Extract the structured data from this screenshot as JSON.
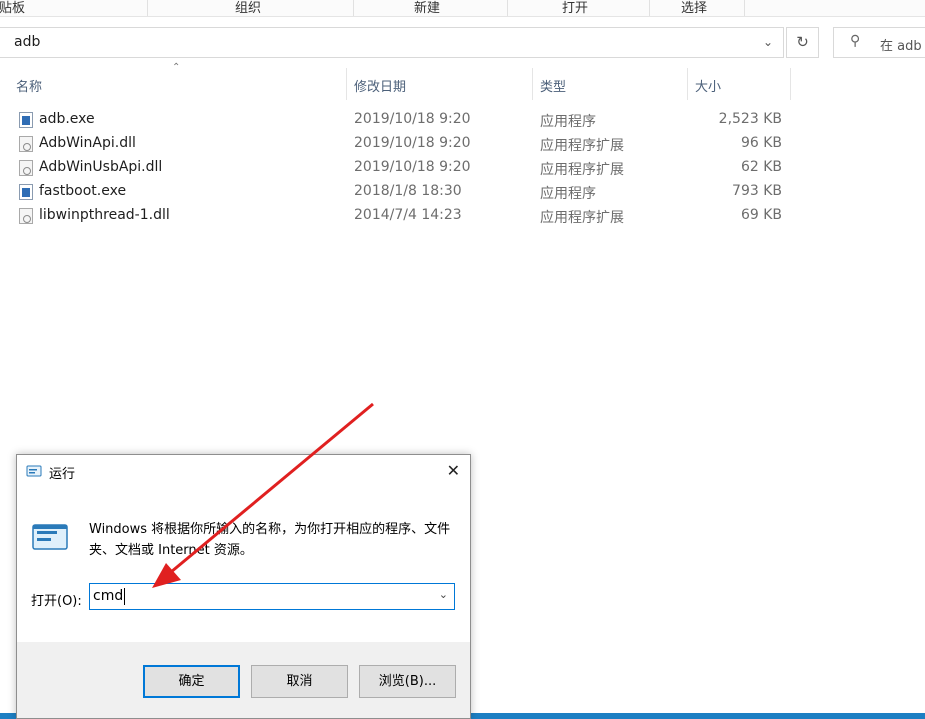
{
  "ribbon": {
    "groups": [
      "粘贴板",
      "组织",
      "新建",
      "打开",
      "选择"
    ]
  },
  "address_bar": {
    "path": "adb",
    "search_placeholder": "在 adb 中搜索"
  },
  "file_list": {
    "columns": [
      "名称",
      "修改日期",
      "类型",
      "大小"
    ],
    "files": [
      {
        "name": "adb.exe",
        "date": "2019/10/18 9:20",
        "type": "应用程序",
        "size": "2,523 KB",
        "icon": "exe-icon"
      },
      {
        "name": "AdbWinApi.dll",
        "date": "2019/10/18 9:20",
        "type": "应用程序扩展",
        "size": "96 KB",
        "icon": "dll-icon"
      },
      {
        "name": "AdbWinUsbApi.dll",
        "date": "2019/10/18 9:20",
        "type": "应用程序扩展",
        "size": "62 KB",
        "icon": "dll-icon"
      },
      {
        "name": "fastboot.exe",
        "date": "2018/1/8 18:30",
        "type": "应用程序",
        "size": "793 KB",
        "icon": "exe-icon"
      },
      {
        "name": "libwinpthread-1.dll",
        "date": "2014/7/4 14:23",
        "type": "应用程序扩展",
        "size": "69 KB",
        "icon": "dll-icon"
      }
    ]
  },
  "run_dialog": {
    "title": "运行",
    "description": "Windows 将根据你所输入的名称，为你打开相应的程序、文件夹、文档或 Internet 资源。",
    "open_label": "打开(O):",
    "input_value": "cmd",
    "ok_label": "确定",
    "cancel_label": "取消",
    "browse_label": "浏览(B)..."
  },
  "colors": {
    "accent": "#0078d7",
    "annotation_arrow": "#e02020",
    "taskbar": "#1d7fc3"
  }
}
